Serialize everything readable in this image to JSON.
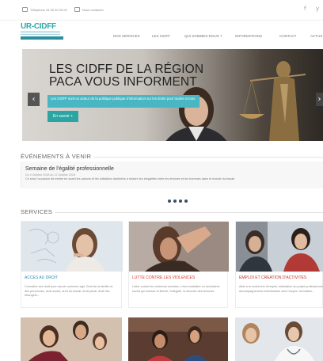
{
  "topbar": {
    "phone": "Téléphone 04 00 00 00 00",
    "mail": "Nous contacter",
    "social": [
      "f",
      "y"
    ]
  },
  "header": {
    "logo": "UR-CIDFF",
    "nav": [
      "NOS SERVICES",
      "LES CIDFF",
      "QUI SOMMES-NOUS ?",
      "INFORMATIONS",
      "CONTACT",
      "ACTUS"
    ]
  },
  "hero": {
    "title": "LES CIDFF DE LA RÉGION PACA VOUS INFORMENT",
    "text": "Les CIDFF sont un acteur de la politique publique d'information sur les droits pour toutes et tous",
    "button": "En savoir +",
    "prev_icon": "chevron-left-icon",
    "next_icon": "chevron-right-icon",
    "prev_glyph": "‹",
    "next_glyph": "›"
  },
  "events": {
    "heading": "ÉVÉNEMENTS À VENIR",
    "title": "Semaine de l'égalité professionnelle",
    "date": "Du 4 Octobre 2018 au 11 Octobre 2018",
    "description": "Ce sera l'occasion de mettre en avant les actions et les initiatives destinées à réduire les inégalités entre les femmes et les hommes dans le monde du travail."
  },
  "services": {
    "heading": "SERVICES",
    "cards": [
      {
        "title": "ACCES AU DROIT",
        "text": "Connaître ses droit pour savoir comment agir. Droit de la famille et des personnes, droit social, droit du travail, droit pénal, droit des étrangers..."
      },
      {
        "title": "LUTTE CONTRE LES VIOLENCES",
        "text": "Lutter contre les violences sexistes, c'est combattre un archaïsme social qui entrave la liberté, l'intégrité, la sécurité des femmes"
      },
      {
        "title": "EMPLOI ET CREATION D'ACTIVITES",
        "text": "Aide à la recherche d'emploi, réalisation du projet professionnel, accompagnement individualisé vers l'emploi, formation..."
      }
    ]
  },
  "colors": {
    "accent": "#2aa5a4",
    "hero_box": "#49b7c3",
    "red": "#e0392b",
    "blue": "#2a8fbd"
  }
}
